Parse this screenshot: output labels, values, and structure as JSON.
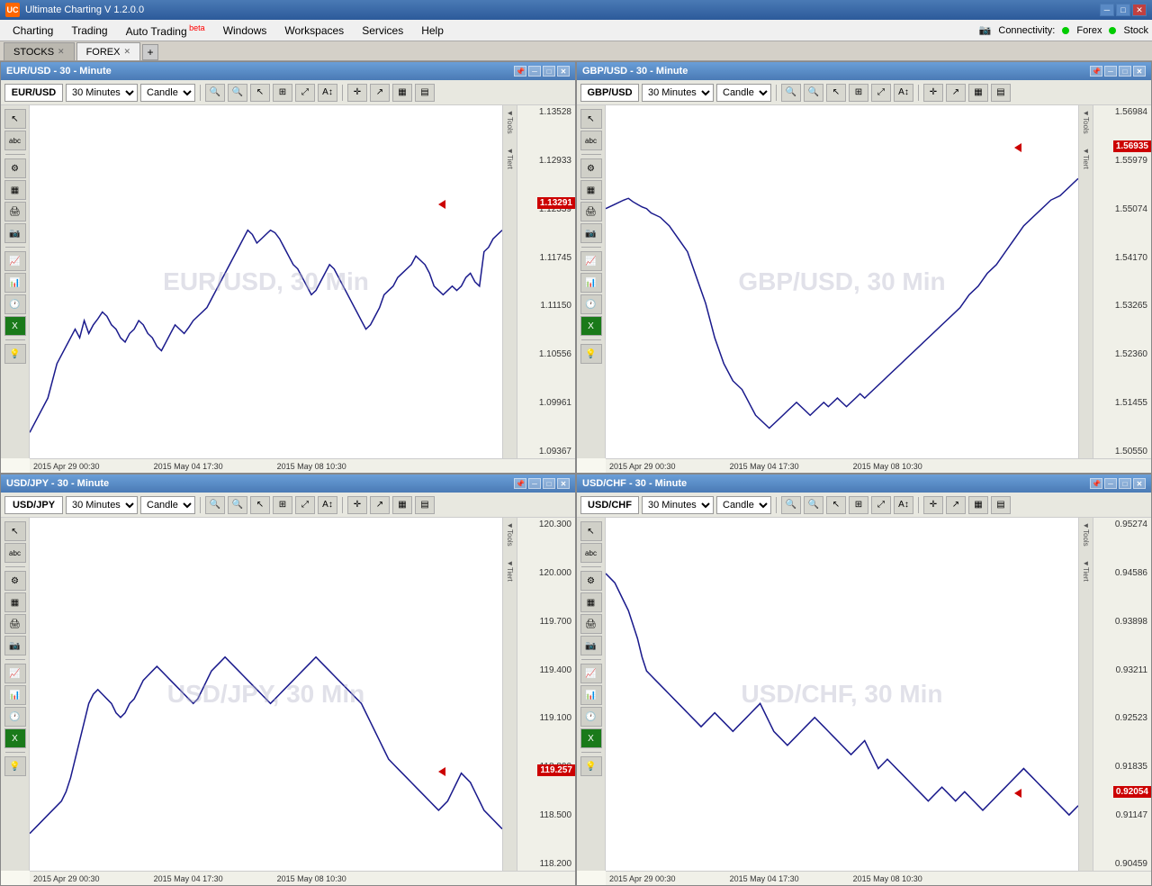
{
  "app": {
    "title": "Ultimate Charting V 1.2.0.0",
    "logo": "UC"
  },
  "menu": {
    "items": [
      {
        "label": "Charting",
        "id": "charting"
      },
      {
        "label": "Trading",
        "id": "trading"
      },
      {
        "label": "Auto Trading",
        "id": "auto-trading",
        "badge": "beta"
      },
      {
        "label": "Windows",
        "id": "windows"
      },
      {
        "label": "Workspaces",
        "id": "workspaces"
      },
      {
        "label": "Services",
        "id": "services"
      },
      {
        "label": "Help",
        "id": "help"
      }
    ],
    "connectivity_label": "Connectivity:",
    "forex_label": "Forex",
    "stock_label": "Stock",
    "camera_icon": "📷"
  },
  "tabs": [
    {
      "label": "STOCKS",
      "id": "stocks",
      "active": false
    },
    {
      "label": "FOREX",
      "id": "forex",
      "active": true
    }
  ],
  "charts": [
    {
      "id": "eurusd",
      "title": "EUR/USD - 30 - Minute",
      "symbol": "EUR/USD",
      "timeframe": "30 Minutes",
      "charttype": "Candle",
      "watermark": "EUR/USD, 30 Min",
      "current_price": "1.13291",
      "price_levels": [
        "1.13528",
        "1.12933",
        "1.12339",
        "1.11745",
        "1.11150",
        "1.10556",
        "1.09961",
        "1.09367"
      ],
      "time_labels": [
        "2015 Apr 29 00:30",
        "2015 May 04 17:30",
        "2015 May 08 10:30"
      ],
      "price_arrow_top_pct": 28,
      "color": "#1a1a8c"
    },
    {
      "id": "gbpusd",
      "title": "GBP/USD - 30 - Minute",
      "symbol": "GBP/USD",
      "timeframe": "30 Minutes",
      "charttype": "Candle",
      "watermark": "GBP/USD, 30 Min",
      "current_price": "1.56935",
      "price_levels": [
        "1.56984",
        "1.55979",
        "1.55074",
        "1.54170",
        "1.53265",
        "1.52360",
        "1.51455",
        "1.50550"
      ],
      "time_labels": [
        "2015 Apr 29 00:30",
        "2015 May 04 17:30",
        "2015 May 08 10:30"
      ],
      "price_arrow_top_pct": 12,
      "color": "#1a1a8c"
    },
    {
      "id": "usdjpy",
      "title": "USD/JPY - 30 - Minute",
      "symbol": "USD/JPY",
      "timeframe": "30 Minutes",
      "charttype": "Candle",
      "watermark": "USD/JPY, 30 Min",
      "current_price": "119.257",
      "price_levels": [
        "120.300",
        "120.000",
        "119.700",
        "119.400",
        "119.100",
        "118.800",
        "118.500",
        "118.200"
      ],
      "time_labels": [
        "2015 Apr 29 00:30",
        "2015 May 04 17:30",
        "2015 May 08 10:30"
      ],
      "price_arrow_top_pct": 72,
      "color": "#1a1a8c"
    },
    {
      "id": "usdchf",
      "title": "USD/CHF - 30 - Minute",
      "symbol": "USD/CHF",
      "timeframe": "30 Minutes",
      "charttype": "Candle",
      "watermark": "USD/CHF, 30 Min",
      "current_price": "0.92054",
      "price_levels": [
        "0.95274",
        "0.94586",
        "0.93898",
        "0.93211",
        "0.92523",
        "0.91835",
        "0.91147",
        "0.90459"
      ],
      "time_labels": [
        "2015 Apr 29 00:30",
        "2015 May 04 17:30",
        "2015 May 08 10:30"
      ],
      "price_arrow_top_pct": 78,
      "color": "#1a1a8c"
    }
  ],
  "toolbar_buttons": {
    "zoom_in": "+",
    "zoom_out": "-",
    "cursor": "↖",
    "zoom_area": "⊞",
    "fit": "⤢",
    "text": "T",
    "crosshair": "+",
    "line": "/",
    "bar": "▦",
    "indicator": "📈"
  }
}
